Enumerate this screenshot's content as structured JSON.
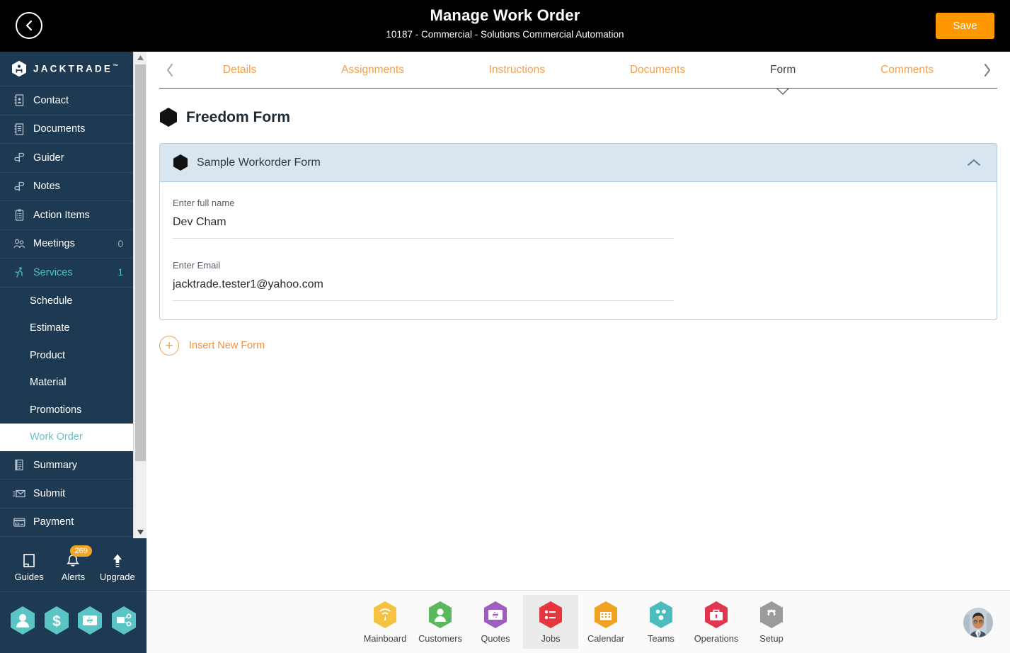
{
  "topbar": {
    "back_icon": "chevron-left-circle-icon",
    "title": "Manage Work Order",
    "subtitle": "10187 - Commercial - Solutions Commercial Automation",
    "save_label": "Save",
    "save_color": "#ff9800",
    "bg_color": "#000000"
  },
  "sidebar": {
    "brand": "JACKTRADE",
    "brand_tm": "™",
    "bg_color": "#1e3a52",
    "accent_teal": "#4fc3c7",
    "items": [
      {
        "label": "Contact",
        "icon": "contact-book-icon",
        "count": ""
      },
      {
        "label": "Documents",
        "icon": "documents-icon",
        "count": ""
      },
      {
        "label": "Guider",
        "icon": "guider-signpost-icon",
        "count": ""
      },
      {
        "label": "Notes",
        "icon": "notes-signpost-icon",
        "count": ""
      },
      {
        "label": "Action Items",
        "icon": "clipboard-icon",
        "count": ""
      },
      {
        "label": "Meetings",
        "icon": "meetings-icon",
        "count": "0"
      },
      {
        "label": "Services",
        "icon": "services-runner-icon",
        "count": "1",
        "active": true
      }
    ],
    "sub_items": [
      {
        "label": "Schedule"
      },
      {
        "label": "Estimate"
      },
      {
        "label": "Product"
      },
      {
        "label": "Material"
      },
      {
        "label": "Promotions"
      },
      {
        "label": "Work Order",
        "active": true
      }
    ],
    "items_after": [
      {
        "label": "Summary",
        "icon": "summary-book-icon",
        "count": ""
      },
      {
        "label": "Submit",
        "icon": "submit-envelope-icon",
        "count": ""
      },
      {
        "label": "Payment",
        "icon": "payment-card-icon",
        "count": ""
      }
    ],
    "tools": [
      {
        "label": "Guides",
        "icon": "guides-book-icon",
        "badge": ""
      },
      {
        "label": "Alerts",
        "icon": "bell-icon",
        "badge": "269"
      },
      {
        "label": "Upgrade",
        "icon": "upgrade-arrow-icon",
        "badge": ""
      }
    ],
    "hex_shortcuts": [
      {
        "name": "person-hex-icon"
      },
      {
        "name": "dollar-hex-icon"
      },
      {
        "name": "money-transfer-hex-icon"
      },
      {
        "name": "workflow-hex-icon"
      }
    ]
  },
  "tabs": {
    "prev_icon": "chevron-left-icon",
    "next_icon": "chevron-right-icon",
    "items": [
      {
        "label": "Details",
        "active": false
      },
      {
        "label": "Assignments",
        "active": false
      },
      {
        "label": "Instructions",
        "active": false
      },
      {
        "label": "Documents",
        "active": false
      },
      {
        "label": "Form",
        "active": true
      },
      {
        "label": "Comments",
        "active": false
      }
    ]
  },
  "page": {
    "heading": "Freedom Form",
    "heading_icon": "hexagon-icon"
  },
  "form_card": {
    "icon": "hexagon-icon",
    "title": "Sample Workorder Form",
    "collapse_icon": "chevron-up-icon",
    "header_bg": "#d9e6ef",
    "fields": [
      {
        "label": "Enter full name",
        "value": "Dev Cham",
        "placeholder": "Enter full name"
      },
      {
        "label": "Enter Email",
        "value": "jacktrade.tester1@yahoo.com",
        "placeholder": "Enter Email"
      }
    ]
  },
  "insert_form": {
    "icon": "plus-circle-icon",
    "label": "Insert New Form",
    "color": "#f5923d"
  },
  "bottom_nav": {
    "items": [
      {
        "label": "Mainboard",
        "icon": "mainboard-hex-icon",
        "color": "#f5c242",
        "active": false
      },
      {
        "label": "Customers",
        "icon": "customers-hex-icon",
        "color": "#5cb85c",
        "active": false
      },
      {
        "label": "Quotes",
        "icon": "quotes-hex-icon",
        "color": "#a05fc0",
        "active": false
      },
      {
        "label": "Jobs",
        "icon": "jobs-hex-icon",
        "color": "#e8343c",
        "active": true
      },
      {
        "label": "Calendar",
        "icon": "calendar-hex-icon",
        "color": "#f0a322",
        "active": false
      },
      {
        "label": "Teams",
        "icon": "teams-hex-icon",
        "color": "#4cbcbf",
        "active": false
      },
      {
        "label": "Operations",
        "icon": "operations-hex-icon",
        "color": "#e0364f",
        "active": false
      },
      {
        "label": "Setup",
        "icon": "setup-gear-hex-icon",
        "color": "#9b9b9b",
        "active": false
      }
    ],
    "avatar_icon": "user-avatar-photo"
  }
}
